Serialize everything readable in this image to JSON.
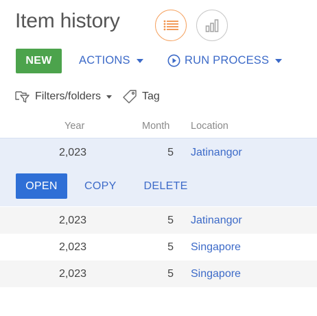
{
  "header": {
    "title": "Item history",
    "view_list_icon": "list-icon",
    "view_chart_icon": "bar-chart-icon",
    "accent_color": "#f5a362"
  },
  "toolbar": {
    "new_label": "NEW",
    "new_color": "#4ca34c",
    "actions_label": "ACTIONS",
    "run_process_label": "RUN PROCESS",
    "run_process_icon": "play-circle-icon",
    "link_color": "#3c6ac8"
  },
  "filters": {
    "filters_label": "Filters/folders",
    "filters_icon": "filter-folder-icon",
    "tag_label": "Tag",
    "tag_icon": "tag-icon"
  },
  "grid": {
    "columns": [
      "Year",
      "Month",
      "Location"
    ],
    "rows": [
      {
        "year": "2,023",
        "month": "5",
        "location": "Jatinangor"
      },
      {
        "year": "2,023",
        "month": "5",
        "location": "Jatinangor"
      },
      {
        "year": "2,023",
        "month": "5",
        "location": "Singapore"
      },
      {
        "year": "2,023",
        "month": "5",
        "location": "Singapore"
      }
    ],
    "selected_row_actions": {
      "open": "OPEN",
      "copy": "COPY",
      "delete": "DELETE"
    },
    "open_color": "#2f6fd6"
  }
}
